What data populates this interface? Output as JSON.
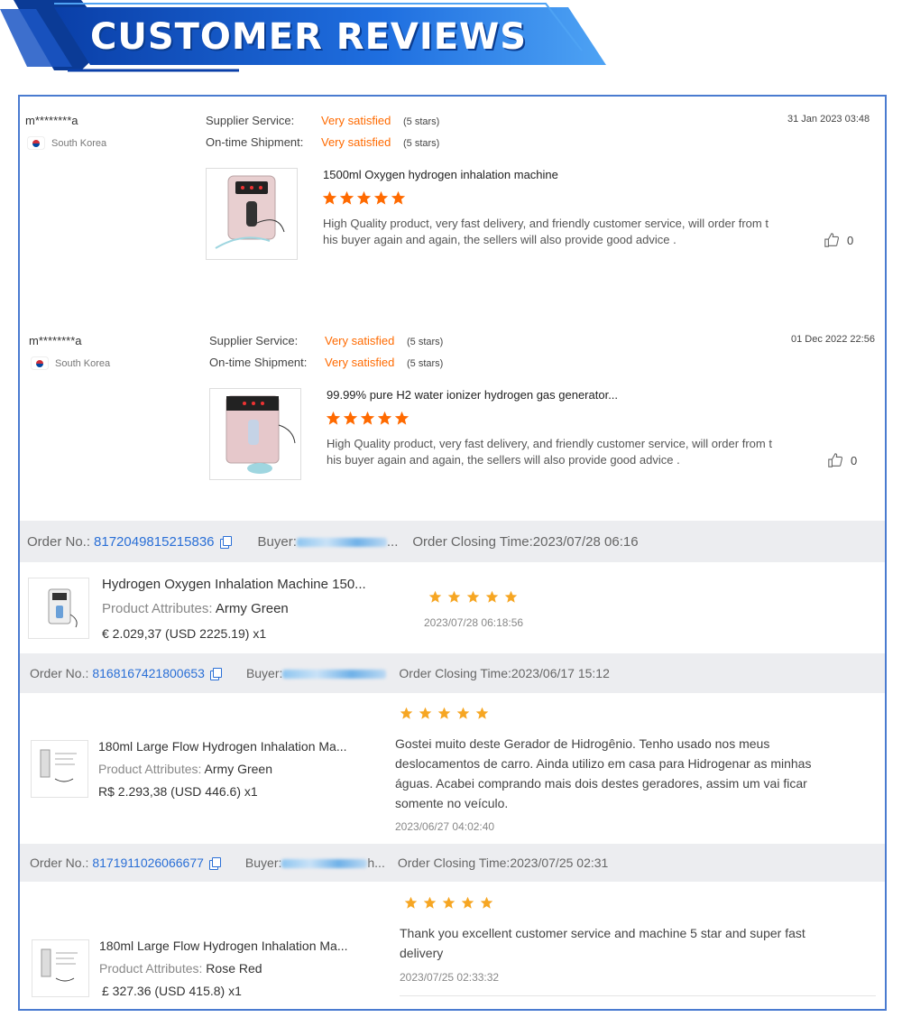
{
  "banner": {
    "title": "CUSTOMER REVIEWS"
  },
  "colors": {
    "accent_orange": "#ff6a00",
    "star_gold": "#f6a623",
    "link_blue": "#2a6fd6",
    "frame_blue": "#4a7bd0"
  },
  "reviews": [
    {
      "name": "m********a",
      "country": "South Korea",
      "supplier_label": "Supplier Service:",
      "supplier_value": "Very satisfied",
      "supplier_stars": "(5 stars)",
      "shipment_label": "On-time Shipment:",
      "shipment_value": "Very satisfied",
      "shipment_stars": "(5 stars)",
      "date": "31 Jan 2023 03:48",
      "product": "1500ml Oxygen hydrogen inhalation machine",
      "rating": 5,
      "text": "High Quality product, very fast delivery, and friendly customer service, will order from this buyer again and again, the sellers will also provide good advice .",
      "likes": "0"
    },
    {
      "name": "m********a",
      "country": "South Korea",
      "supplier_label": "Supplier Service:",
      "supplier_value": "Very satisfied",
      "supplier_stars": "(5 stars)",
      "shipment_label": "On-time Shipment:",
      "shipment_value": "Very satisfied",
      "shipment_stars": "(5 stars)",
      "date": "01 Dec 2022 22:56",
      "product": "99.99% pure H2 water ionizer hydrogen gas generator...",
      "rating": 5,
      "text": "High Quality product, very fast delivery, and friendly customer service, will order from this buyer again and again, the sellers will also provide good advice .",
      "likes": "0"
    }
  ],
  "orders": [
    {
      "order_label": "Order No.:",
      "order_no": "8172049815215836",
      "buyer_label": "Buyer:",
      "buyer_suffix": "...",
      "closing": "Order Closing Time:2023/07/28 06:16",
      "title": "Hydrogen Oxygen Inhalation Machine 150...",
      "attr_label": "Product Attributes:",
      "attr_value": "Army Green",
      "price": "€ 2.029,37 (USD  2225.19)  x1",
      "rating": 5,
      "comment": "",
      "time": "2023/07/28 06:18:56"
    },
    {
      "order_label": "Order No.:",
      "order_no": "8168167421800653",
      "buyer_label": "Buyer:",
      "buyer_suffix": "",
      "closing": "Order Closing Time:2023/06/17 15:12",
      "title": "180ml Large Flow Hydrogen Inhalation Ma...",
      "attr_label": "Product Attributes:",
      "attr_value": "Army Green",
      "price": "R$ 2.293,38  (USD  446.6)  x1",
      "rating": 5,
      "comment": "Gostei muito deste Gerador de Hidrogênio. Tenho usado nos meus deslocamentos de carro. Ainda utilizo em casa para Hidrogenar as minhas águas. Acabei comprando mais dois destes geradores, assim um vai ficar somente no veículo.",
      "time": "2023/06/27 04:02:40"
    },
    {
      "order_label": "Order No.:",
      "order_no": "8171911026066677",
      "buyer_label": "Buyer:",
      "buyer_suffix": "h...",
      "closing": "Order Closing Time:2023/07/25 02:31",
      "title": "180ml Large Flow Hydrogen Inhalation Ma...",
      "attr_label": "Product Attributes:",
      "attr_value": "Rose Red",
      "price": "£ 327.36  (USD  415.8)  x1",
      "rating": 5,
      "comment": "Thank you excellent customer service and machine 5 star and super fast delivery",
      "time": "2023/07/25 02:33:32"
    }
  ]
}
